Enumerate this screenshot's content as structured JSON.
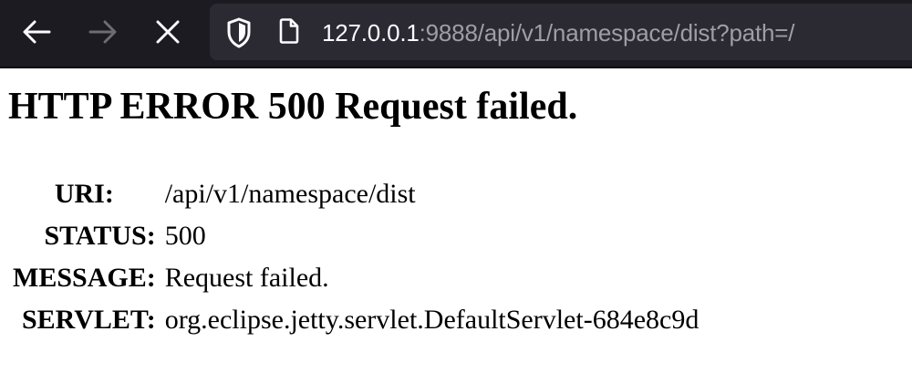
{
  "browser": {
    "back_icon": "arrow-left-icon",
    "forward_icon": "arrow-right-icon",
    "stop_icon": "close-icon",
    "tracking_icon": "shield-icon",
    "page_icon": "document-icon",
    "url_host": "127.0.0.1",
    "url_rest": ":9888/api/v1/namespace/dist?path=/",
    "toolbar_color": "#1c1b22",
    "urlbar_color": "#2b2a33"
  },
  "page": {
    "heading": "HTTP ERROR 500 Request failed.",
    "rows": [
      {
        "label": "URI:",
        "value": "/api/v1/namespace/dist"
      },
      {
        "label": "STATUS:",
        "value": "500"
      },
      {
        "label": "MESSAGE:",
        "value": "Request failed."
      },
      {
        "label": "SERVLET:",
        "value": "org.eclipse.jetty.servlet.DefaultServlet-684e8c9d"
      }
    ]
  }
}
